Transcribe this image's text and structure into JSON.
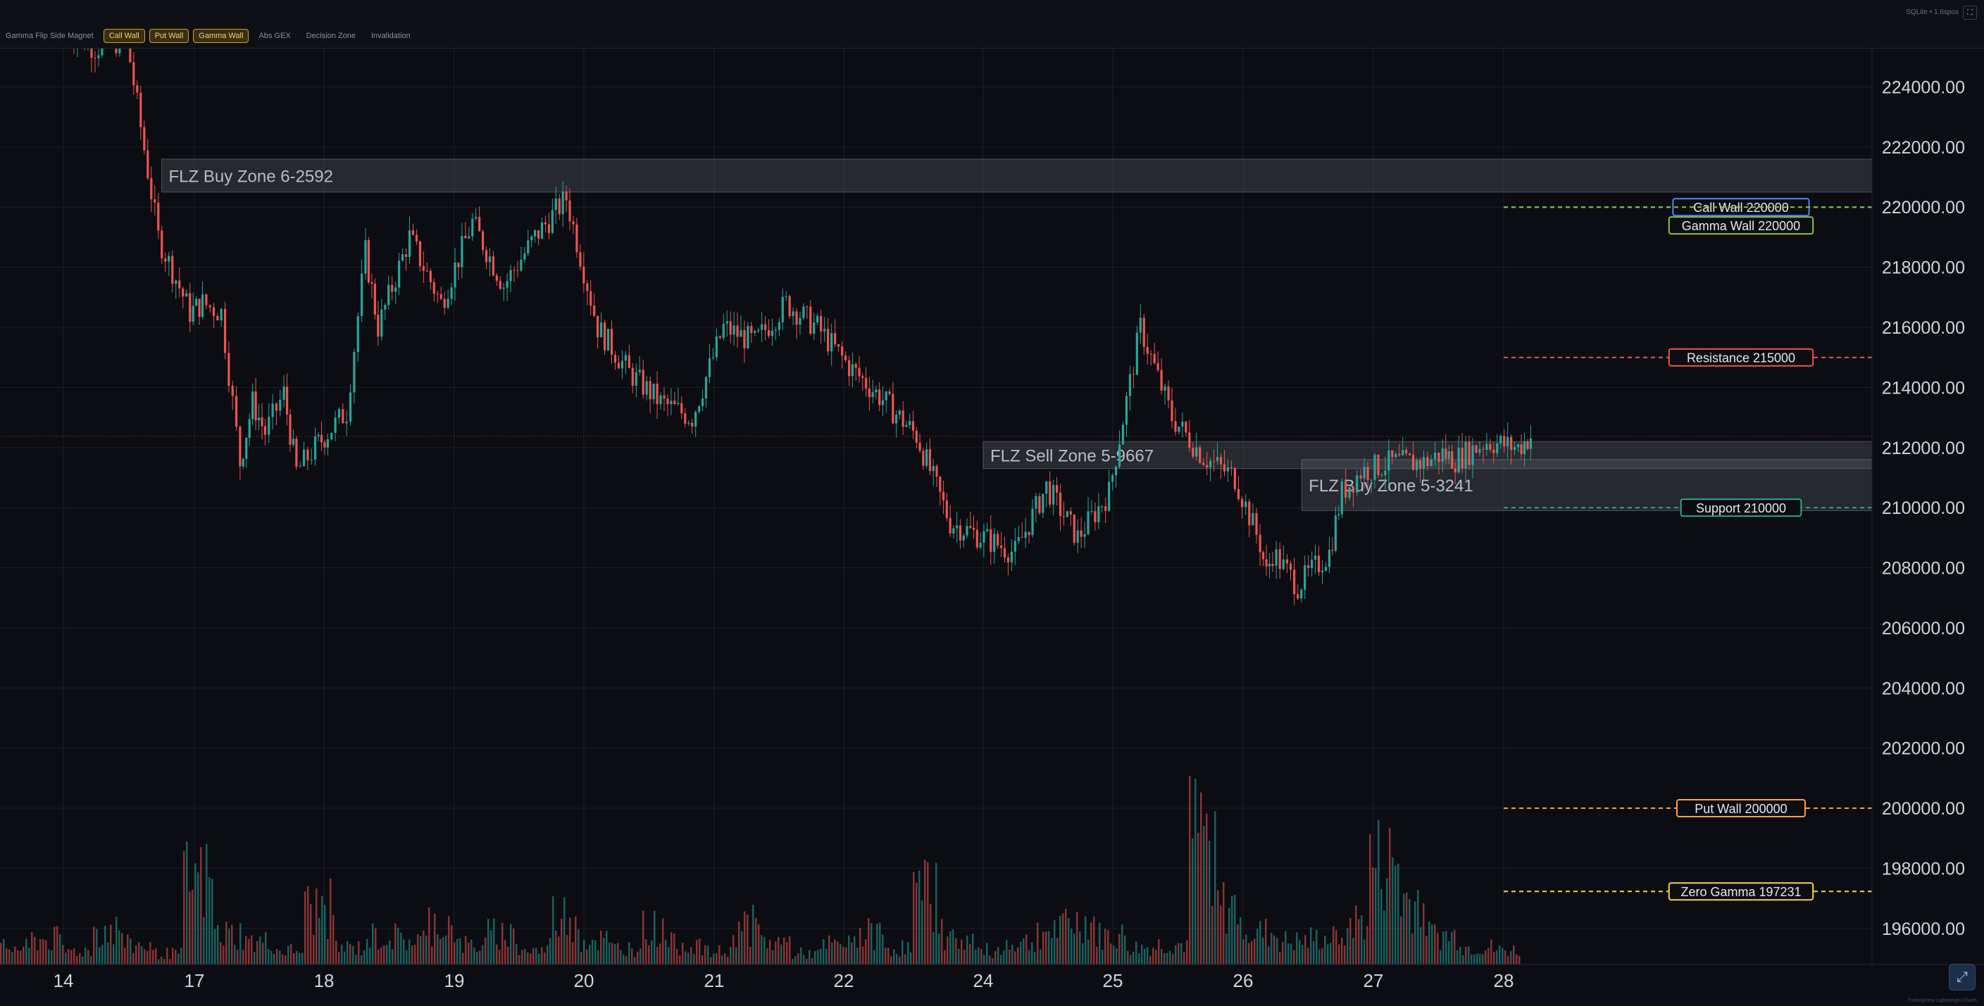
{
  "toolbar": {
    "items": [
      {
        "label": "Gamma Flip Side Magnet",
        "state": "off"
      },
      {
        "label": "Call Wall",
        "state": "on"
      },
      {
        "label": "Put Wall",
        "state": "on"
      },
      {
        "label": "Gamma Wall",
        "state": "on"
      },
      {
        "label": "Abs GEX",
        "state": "off"
      },
      {
        "label": "Decision Zone",
        "state": "off"
      },
      {
        "label": "Invalidation",
        "state": "off"
      }
    ],
    "source_label": "SQLite • 1.6spos"
  },
  "attribution": "TradingView Lightweight Charts",
  "colors": {
    "background": "#0b0d12",
    "grid": "#1a1e27",
    "up": "#26a69a",
    "down": "#ef5350",
    "last_price": "#ef5350",
    "call_wall": "#4f83ff",
    "gamma_wall": "#8bc34a",
    "resistance": "#ef5350",
    "support": "#26a69a",
    "put_wall": "#ff9f43",
    "zero_gamma": "#f5d547",
    "zone_fill": "#5a5e66"
  },
  "chart_data": {
    "type": "candlestick",
    "title": "",
    "x_tick_labels": [
      "14",
      "17",
      "18",
      "19",
      "20",
      "21",
      "22",
      "24",
      "25",
      "26",
      "27",
      "28"
    ],
    "y_tick_labels": [
      "224000.00",
      "222000.00",
      "220000.00",
      "218000.00",
      "216000.00",
      "214000.00",
      "212000.00",
      "210000.00",
      "208000.00",
      "206000.00",
      "204000.00",
      "202000.00",
      "200000.00",
      "198000.00",
      "196000.00"
    ],
    "ylim": [
      194800,
      225300
    ],
    "grid": true,
    "price_path_x": [
      0,
      0.5,
      1.0,
      1.5,
      2.0,
      2.2,
      2.5,
      2.8,
      3.0,
      3.2,
      3.5,
      3.7,
      4.0,
      4.2,
      4.5,
      4.8,
      5.0,
      5.5,
      6.0,
      6.5,
      7.0,
      7.5,
      8.0,
      8.5,
      9.0,
      9.5,
      10.0,
      10.5,
      11.0,
      11.5,
      12.0,
      12.5,
      13.0,
      13.5,
      14.0,
      14.5,
      15.0,
      15.5,
      16.0,
      16.5,
      17.0,
      17.5,
      18.0,
      18.5,
      18.9,
      19.0,
      19.1,
      19.5,
      20.0,
      20.2,
      20.5,
      21.0,
      21.5,
      21.8,
      22.0,
      22.5,
      23.0,
      23.2
    ],
    "price_path_y": [
      226000,
      225300,
      225600,
      219000,
      216500,
      216800,
      216500,
      211500,
      213500,
      212500,
      213800,
      211200,
      212000,
      212500,
      213200,
      218500,
      216000,
      219000,
      216800,
      219500,
      217400,
      219000,
      220300,
      216000,
      214500,
      213500,
      213000,
      216000,
      215500,
      216800,
      216000,
      214700,
      213600,
      212400,
      209500,
      209000,
      208500,
      210700,
      209000,
      210500,
      216000,
      213000,
      211700,
      211000,
      208800,
      207800,
      208500,
      207400,
      208500,
      210500,
      211200,
      211500,
      211500,
      211800,
      211600,
      212200,
      212000,
      212375
    ],
    "price_path_x_unit": "trading days since 14",
    "last_price": "212375.00",
    "volume_last": "1.81K",
    "horizontal_levels": [
      {
        "name": "Call Wall",
        "label": "Call Wall 220000",
        "value": 220000,
        "color_key": "call_wall"
      },
      {
        "name": "Gamma Wall",
        "label": "Gamma Wall 220000",
        "value": 220000,
        "color_key": "gamma_wall"
      },
      {
        "name": "Resistance",
        "label": "Resistance 215000",
        "value": 215000,
        "color_key": "resistance"
      },
      {
        "name": "Support",
        "label": "Support 210000",
        "value": 210000,
        "color_key": "support"
      },
      {
        "name": "Put Wall",
        "label": "Put Wall 200000",
        "value": 200000,
        "color_key": "put_wall"
      },
      {
        "name": "Zero Gamma",
        "label": "Zero Gamma 197231",
        "value": 197231,
        "color_key": "zero_gamma"
      }
    ],
    "zones": [
      {
        "label": "FLZ Buy Zone 6-2592",
        "low": 220500,
        "high": 221600,
        "x_start": 0.75,
        "x_end": 30
      },
      {
        "label": "FLZ Sell Zone 5-9667",
        "low": 211300,
        "high": 212200,
        "x_start": 7.0,
        "x_end": 30
      },
      {
        "label": "FLZ Buy Zone 5-3241",
        "low": 209900,
        "high": 211600,
        "x_start": 9.45,
        "x_end": 30
      }
    ],
    "volume_profile": [
      12,
      18,
      10,
      25,
      14,
      8,
      60,
      22,
      16,
      10,
      40,
      12,
      20,
      18,
      30,
      14,
      22,
      10,
      35,
      18,
      12,
      26,
      15,
      9,
      28,
      16,
      8,
      14,
      22,
      12,
      50,
      18,
      10,
      16,
      24,
      30,
      20,
      12,
      14,
      90,
      40,
      22,
      16,
      18,
      30,
      70,
      45,
      20,
      12,
      10
    ]
  }
}
